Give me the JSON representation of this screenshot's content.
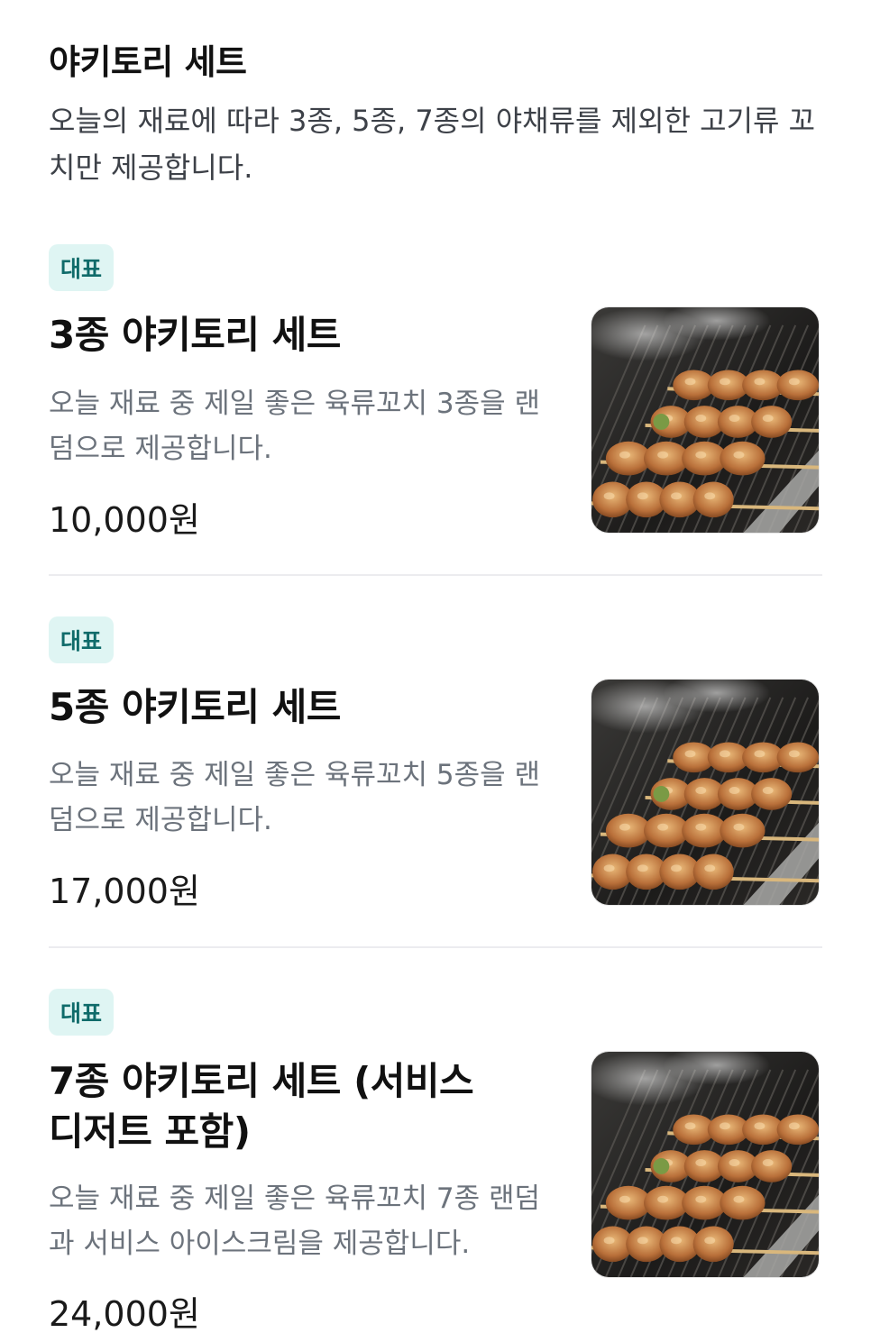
{
  "section": {
    "title": "야키토리 세트",
    "description": "오늘의 재료에 따라 3종, 5종, 7종의 야채류를 제외한 고기류 꼬치만 제공합니다."
  },
  "items": [
    {
      "badge": "대표",
      "title": "3종 야키토리 세트",
      "description": "오늘 재료 중 제일 좋은 육류꼬치 3종을 랜덤으로 제공합니다.",
      "price": "10,000원",
      "image_icon": "yakitori-grill-photo"
    },
    {
      "badge": "대표",
      "title": "5종 야키토리 세트",
      "description": "오늘 재료 중 제일 좋은 육류꼬치 5종을 랜덤으로 제공합니다.",
      "price": "17,000원",
      "image_icon": "yakitori-grill-photo"
    },
    {
      "badge": "대표",
      "title": "7종 야키토리 세트 (서비스 디저트 포함)",
      "description": "오늘 재료 중 제일 좋은 육류꼬치 7종 랜덤과 서비스 아이스크림을 제공합니다.",
      "price": "24,000원",
      "image_icon": "yakitori-grill-photo"
    }
  ],
  "colors": {
    "badge_bg": "#dff5f3",
    "badge_text": "#0f6b6a",
    "description_text": "#6c737c",
    "divider": "#ececef"
  }
}
